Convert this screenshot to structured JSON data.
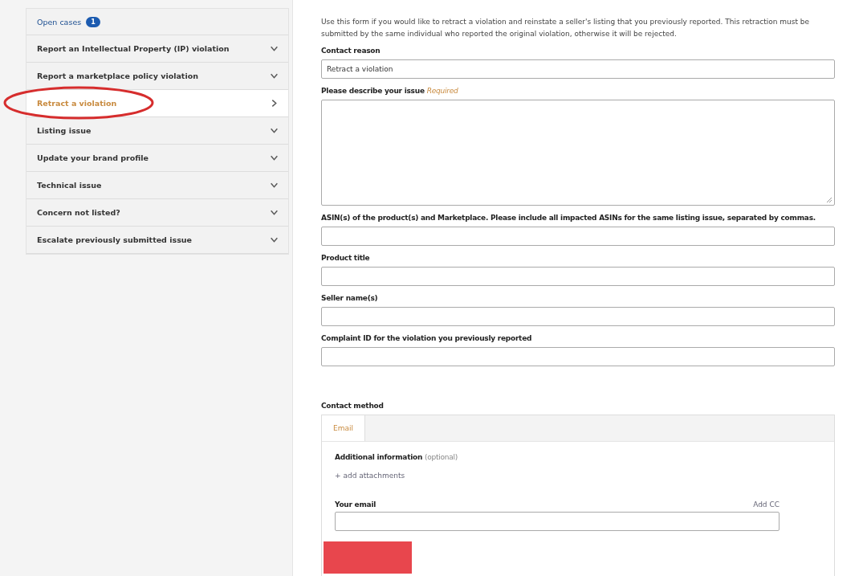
{
  "sidebar": {
    "open_cases": {
      "label": "Open cases",
      "count": "1"
    },
    "items": [
      {
        "label": "Report an Intellectual Property (IP) violation",
        "selected": false,
        "circled": false
      },
      {
        "label": "Report a marketplace policy violation",
        "selected": false,
        "circled": false
      },
      {
        "label": "Retract a violation",
        "selected": true,
        "circled": true
      },
      {
        "label": "Listing issue",
        "selected": false,
        "circled": false
      },
      {
        "label": "Update your brand profile",
        "selected": false,
        "circled": false
      },
      {
        "label": "Technical issue",
        "selected": false,
        "circled": false
      },
      {
        "label": "Concern not listed?",
        "selected": false,
        "circled": false
      },
      {
        "label": "Escalate previously submitted issue",
        "selected": false,
        "circled": false
      }
    ]
  },
  "form": {
    "intro": "Use this form if you would like to retract a violation and reinstate a seller's listing that you previously reported. This retraction must be submitted by the same individual who reported the original violation, otherwise it will be rejected.",
    "fields": [
      {
        "kind": "input",
        "label": "Contact reason",
        "value": "Retract a violation"
      },
      {
        "kind": "textarea",
        "label": "Please describe your issue",
        "note": "Required"
      },
      {
        "kind": "input",
        "label": "ASIN(s) of the product(s) and Marketplace. Please include all impacted ASINs for the same listing issue, separated by commas."
      },
      {
        "kind": "input",
        "label": "Product title"
      },
      {
        "kind": "input",
        "label": "Seller name(s)"
      },
      {
        "kind": "input",
        "label": "Complaint ID for the violation you previously reported"
      }
    ]
  },
  "contact": {
    "label": "Contact method",
    "tabs": [
      {
        "label": "Email",
        "selected": true
      }
    ],
    "additional": {
      "label": "Additional information",
      "note": "(optional)"
    },
    "attach_link": "+ add attachments",
    "email": {
      "label": "Your email",
      "add_cc": "Add CC",
      "redacted": true
    }
  }
}
